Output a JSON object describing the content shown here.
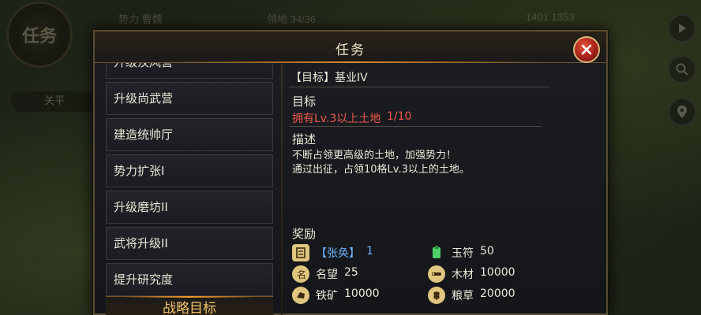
{
  "hud": {
    "renwu_badge": "任务",
    "influence": "势力 曹魏",
    "territory": "领地 34/36",
    "coords": "1401 1353",
    "peace": "关平"
  },
  "dialog": {
    "title": "任务",
    "list_items": [
      {
        "label": "升级汉风营"
      },
      {
        "label": "升级尚武营"
      },
      {
        "label": "建造统帅厅"
      },
      {
        "label": "势力扩张I"
      },
      {
        "label": "升级磨坊II"
      },
      {
        "label": "武将升级II"
      },
      {
        "label": "提升研究度"
      }
    ],
    "strategy_label": "战略目标",
    "detail": {
      "quest_title": "【目标】基业IV",
      "goal_heading": "目标",
      "goal_text": "拥有Lv.3以上土地",
      "goal_progress": "1/10",
      "desc_heading": "描述",
      "desc_line1": "不断占领更高级的土地，加强势力！",
      "desc_line2": "通过出征，占领10格Lv.3以上的土地。",
      "reward_heading": "奖励",
      "rewards_left": [
        {
          "icon": "general-card-icon",
          "label": "【张奂】",
          "value": "1"
        },
        {
          "icon": "fame-icon",
          "label": "名望",
          "value": "25"
        },
        {
          "icon": "iron-ore-icon",
          "label": "铁矿",
          "value": "10000"
        }
      ],
      "rewards_right": [
        {
          "icon": "jade-tally-icon",
          "label": "玉符",
          "value": "50"
        },
        {
          "icon": "wood-icon",
          "label": "木材",
          "value": "10000"
        },
        {
          "icon": "grain-icon",
          "label": "粮草",
          "value": "20000"
        }
      ]
    }
  },
  "colors": {
    "accent_gold": "#f2c26b",
    "progress_red": "#f0584a",
    "hero_blue": "#6fb5ff"
  }
}
